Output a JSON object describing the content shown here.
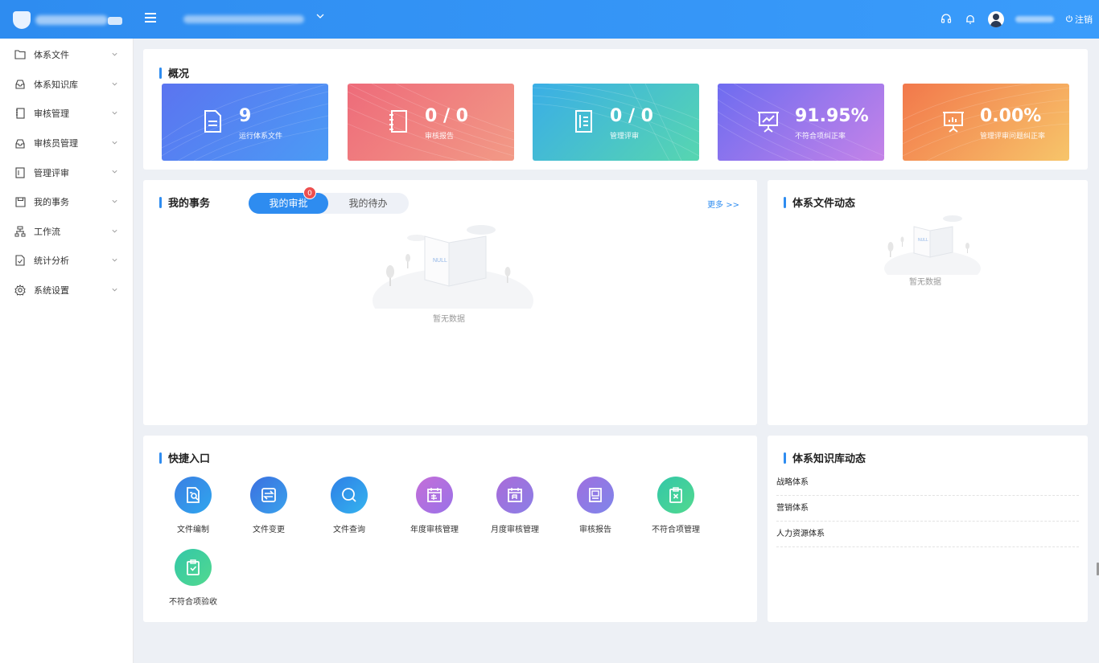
{
  "topbar": {
    "logout_label": "注销",
    "icons": [
      "menu-icon",
      "chevron-down-icon",
      "headset-icon",
      "bell-icon",
      "user-avatar-icon",
      "power-icon"
    ]
  },
  "sidebar": {
    "items": [
      {
        "label": "体系文件",
        "icon": "folder-icon"
      },
      {
        "label": "体系知识库",
        "icon": "inbox-icon"
      },
      {
        "label": "审核管理",
        "icon": "book-icon"
      },
      {
        "label": "审核员管理",
        "icon": "inbox-icon"
      },
      {
        "label": "管理评审",
        "icon": "document-list-icon"
      },
      {
        "label": "我的事务",
        "icon": "save-icon"
      },
      {
        "label": "工作流",
        "icon": "workflow-icon"
      },
      {
        "label": "统计分析",
        "icon": "chart-file-icon"
      },
      {
        "label": "系统设置",
        "icon": "gear-icon"
      }
    ]
  },
  "overview": {
    "title": "概况",
    "cards": [
      {
        "value": "9",
        "label": "运行体系文件",
        "icon": "document-icon"
      },
      {
        "value": "0 / 0",
        "label": "审核报告",
        "icon": "notebook-icon"
      },
      {
        "value": "0 / 0",
        "label": "管理评审",
        "icon": "list-doc-icon"
      },
      {
        "value": "91.95%",
        "label": "不符合项纠正率",
        "icon": "presentation-icon"
      },
      {
        "value": "0.00%",
        "label": "管理评审问题纠正率",
        "icon": "presentation-chart-icon"
      }
    ]
  },
  "affairs": {
    "title": "我的事务",
    "tabs": [
      "我的审批",
      "我的待办"
    ],
    "badge": "0",
    "more": "更多 >>",
    "empty_text": "暂无数据",
    "null_text": "NULL"
  },
  "file_dynamics": {
    "title": "体系文件动态",
    "empty_text": "暂无数据",
    "null_text": "NULL"
  },
  "quick": {
    "title": "快捷入口",
    "items": [
      {
        "label": "文件编制",
        "icon": "file-edit-icon",
        "color": "#3b7fe3"
      },
      {
        "label": "文件变更",
        "icon": "file-change-icon",
        "color": "#3b86e6"
      },
      {
        "label": "文件查询",
        "icon": "search-icon",
        "color": "#2f8de8"
      },
      {
        "label": "年度审核管理",
        "icon": "calendar-year-icon",
        "color": "#b46fd9"
      },
      {
        "label": "月度审核管理",
        "icon": "calendar-month-icon",
        "color": "#9b78e2"
      },
      {
        "label": "审核报告",
        "icon": "report-icon",
        "color": "#8d7be6"
      },
      {
        "label": "不符合项管理",
        "icon": "clipboard-x-icon",
        "color": "#3fcf9a"
      },
      {
        "label": "不符合项验收",
        "icon": "clipboard-check-icon",
        "color": "#3fcf9a"
      }
    ]
  },
  "knowledge": {
    "title": "体系知识库动态",
    "items": [
      "战略体系",
      "营销体系",
      "人力资源体系"
    ]
  }
}
